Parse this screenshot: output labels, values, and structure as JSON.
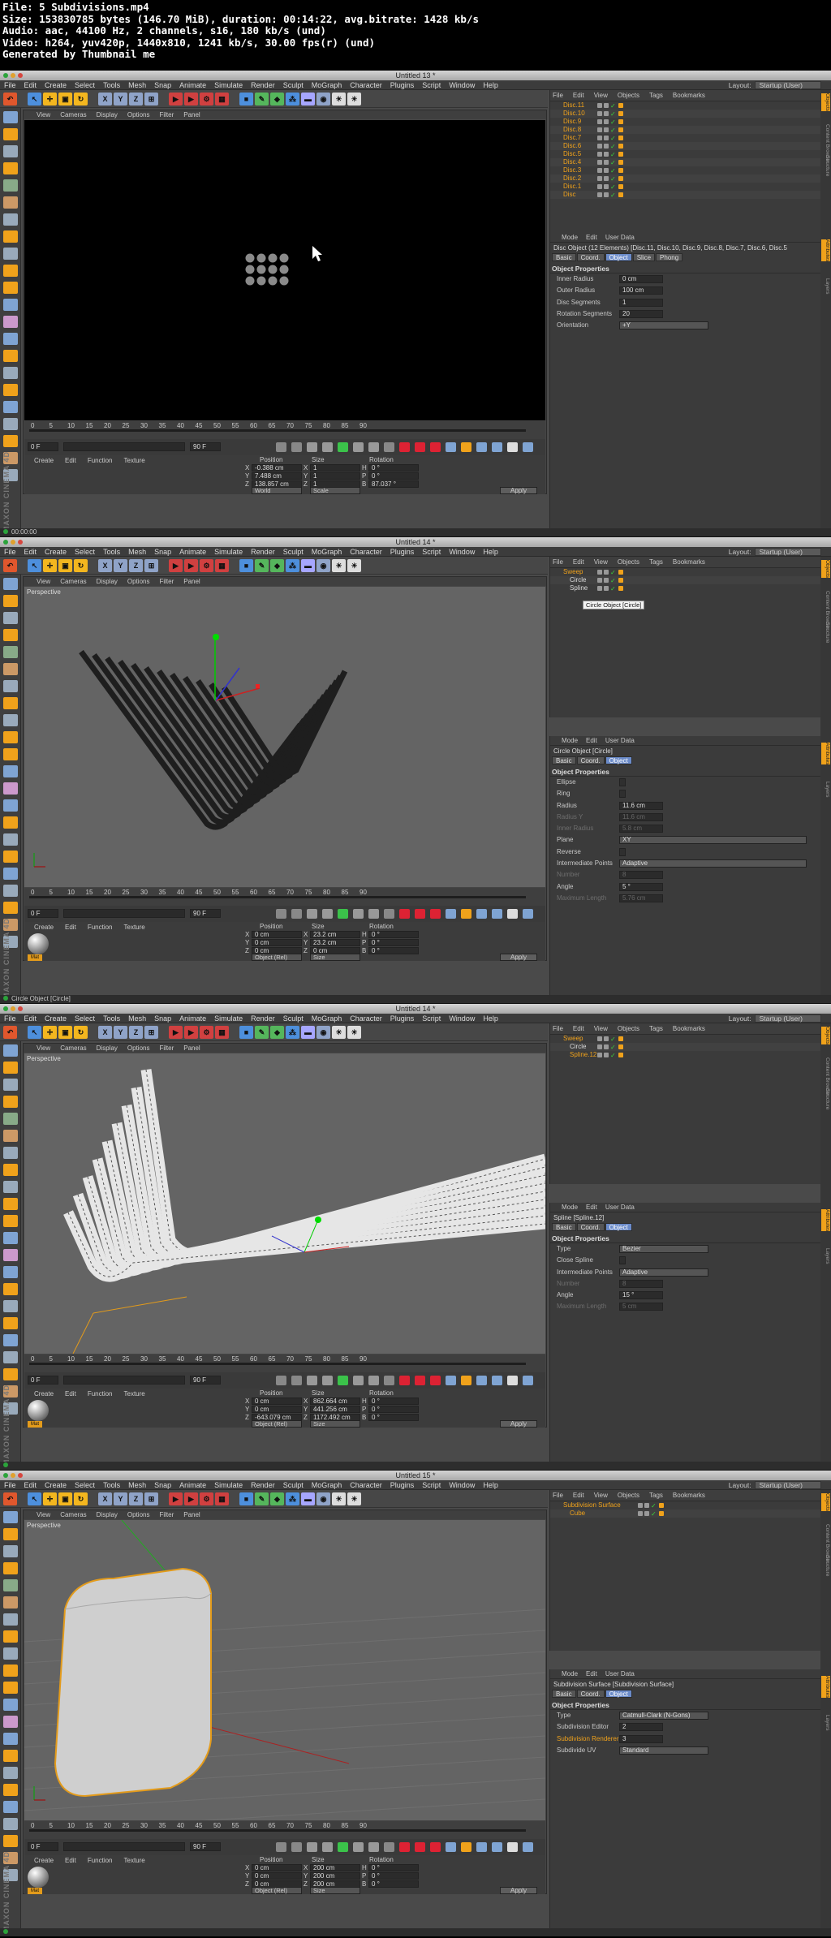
{
  "header": {
    "lines": [
      "File: 5 Subdivisions.mp4",
      "Size: 153830785 bytes (146.70 MiB), duration: 00:14:22, avg.bitrate: 1428 kb/s",
      "Audio: aac, 44100 Hz, 2 channels, s16, 180 kb/s (und)",
      "Video: h264, yuv420p, 1440x810, 1241 kb/s, 30.00 fps(r) (und)",
      "Generated by Thumbnail me"
    ]
  },
  "menu": [
    "File",
    "Edit",
    "Create",
    "Select",
    "Tools",
    "Mesh",
    "Snap",
    "Animate",
    "Simulate",
    "Render",
    "Sculpt",
    "MoGraph",
    "Character",
    "Plugins",
    "Script",
    "Window",
    "Help"
  ],
  "layout": {
    "label": "Layout:",
    "value": "Startup (User)"
  },
  "viewport_menu": [
    "View",
    "Cameras",
    "Display",
    "Options",
    "Filter",
    "Panel"
  ],
  "om_menu": [
    "File",
    "Edit",
    "View",
    "Objects",
    "Tags",
    "Bookmarks"
  ],
  "attr_menu": [
    "Mode",
    "Edit",
    "User Data"
  ],
  "material_menu": [
    "Create",
    "Edit",
    "Function",
    "Texture"
  ],
  "mat_label": "Mat",
  "ticks": [
    "0",
    "5",
    "10",
    "15",
    "20",
    "25",
    "30",
    "35",
    "40",
    "45",
    "50",
    "55",
    "60",
    "65",
    "70",
    "75",
    "80",
    "85",
    "90"
  ],
  "coord_heads": [
    "Position",
    "Size",
    "Rotation"
  ],
  "axes": [
    "X",
    "Y",
    "Z"
  ],
  "rot_axes": [
    "H",
    "P",
    "B"
  ],
  "apply": "Apply",
  "right_tabs": [
    "Attributes",
    "Layers"
  ],
  "right_tabs_top": [
    "Objects",
    "Content Browser",
    "Structure"
  ],
  "frames": [
    {
      "title": "Untitled 13 *",
      "viewport_label": "",
      "objects": [
        "Disc.11",
        "Disc.10",
        "Disc.9",
        "Disc.8",
        "Disc.7",
        "Disc.6",
        "Disc.5",
        "Disc.4",
        "Disc.3",
        "Disc.2",
        "Disc.1",
        "Disc"
      ],
      "attr_title": "Disc Object (12 Elements) [Disc.11, Disc.10, Disc.9, Disc.8, Disc.7, Disc.6, Disc.5",
      "tabs": [
        "Basic",
        "Coord.",
        "Object",
        "Slice",
        "Phong"
      ],
      "active_tab": "Object",
      "section": "Object Properties",
      "props": [
        {
          "label": "Inner Radius",
          "value": "0 cm",
          "kind": "num"
        },
        {
          "label": "Outer Radius",
          "value": "100 cm",
          "kind": "num"
        },
        {
          "label": "Disc Segments",
          "value": "1",
          "kind": "num"
        },
        {
          "label": "Rotation Segments",
          "value": "20",
          "kind": "num"
        },
        {
          "label": "Orientation",
          "value": "+Y",
          "kind": "drop"
        }
      ],
      "frame_start": "0 F",
      "frame_end": "90 F",
      "frame_cur": "0 F",
      "coords": {
        "pos": [
          "-0.388 cm",
          "7.488 cm",
          "138.857 cm"
        ],
        "size": [
          "1",
          "1",
          "1"
        ],
        "rot": [
          "0 °",
          "0 °",
          "87.037 °"
        ]
      },
      "drops": [
        "World",
        "Scale"
      ],
      "status": "00:00:00",
      "show_mat": false
    },
    {
      "title": "Untitled 14 *",
      "viewport_label": "Perspective",
      "objects": [
        "Sweep",
        "Circle",
        "Spline"
      ],
      "tooltip": "Circle Object [Circle]",
      "attr_title": "Circle Object [Circle]",
      "tabs": [
        "Basic",
        "Coord.",
        "Object"
      ],
      "active_tab": "Object",
      "section": "Object Properties",
      "props": [
        {
          "label": "Ellipse",
          "value": "",
          "kind": "box"
        },
        {
          "label": "Ring",
          "value": "",
          "kind": "box"
        },
        {
          "label": "Radius",
          "value": "11.6 cm",
          "kind": "num"
        },
        {
          "label": "Radius Y",
          "value": "11.6 cm",
          "kind": "dimnum"
        },
        {
          "label": "Inner Radius",
          "value": "5.8 cm",
          "kind": "dimnum"
        },
        {
          "label": "Plane",
          "value": "XY",
          "kind": "dropw"
        },
        {
          "label": "Reverse",
          "value": "",
          "kind": "box"
        },
        {
          "label": "Intermediate Points",
          "value": "Adaptive",
          "kind": "dropw"
        },
        {
          "label": "Number",
          "value": "8",
          "kind": "dimnum"
        },
        {
          "label": "Angle",
          "value": "5 °",
          "kind": "num"
        },
        {
          "label": "Maximum Length",
          "value": "5.76 cm",
          "kind": "dimnum"
        }
      ],
      "frame_start": "0 F",
      "frame_end": "90 F",
      "frame_cur": "0 F",
      "coords": {
        "pos": [
          "0 cm",
          "0 cm",
          "0 cm"
        ],
        "size": [
          "23.2 cm",
          "23.2 cm",
          "0 cm"
        ],
        "rot": [
          "0 °",
          "0 °",
          "0 °"
        ]
      },
      "drops": [
        "Object (Rel)",
        "Size"
      ],
      "status": "Circle Object [Circle]",
      "show_mat": true
    },
    {
      "title": "Untitled 14 *",
      "viewport_label": "Perspective",
      "objects": [
        "Sweep",
        "Circle",
        "Spline.12"
      ],
      "attr_title": "Spline [Spline.12]",
      "tabs": [
        "Basic",
        "Coord.",
        "Object"
      ],
      "active_tab": "Object",
      "section": "Object Properties",
      "props": [
        {
          "label": "Type",
          "value": "Bezier",
          "kind": "drop"
        },
        {
          "label": "Close Spline",
          "value": "",
          "kind": "box"
        },
        {
          "label": "Intermediate Points",
          "value": "Adaptive",
          "kind": "drop"
        },
        {
          "label": "Number",
          "value": "8",
          "kind": "dimnum"
        },
        {
          "label": "Angle",
          "value": "15 °",
          "kind": "num"
        },
        {
          "label": "Maximum Length",
          "value": "5 cm",
          "kind": "dimnum"
        }
      ],
      "frame_start": "0 F",
      "frame_end": "90 F",
      "frame_cur": "0 F",
      "coords": {
        "pos": [
          "0 cm",
          "0 cm",
          "-643.079 cm"
        ],
        "size": [
          "862.664 cm",
          "441.256 cm",
          "1172.492 cm"
        ],
        "rot": [
          "0 °",
          "0 °",
          "0 °"
        ]
      },
      "drops": [
        "Object (Rel)",
        "Size"
      ],
      "status": "",
      "show_mat": true
    },
    {
      "title": "Untitled 15 *",
      "viewport_label": "Perspective",
      "objects": [
        "Subdivision Surface",
        "Cube"
      ],
      "attr_title": "Subdivision Surface [Subdivision Surface]",
      "tabs": [
        "Basic",
        "Coord.",
        "Object"
      ],
      "active_tab": "Object",
      "section": "Object Properties",
      "props": [
        {
          "label": "Type",
          "value": "Catmull-Clark (N-Gons)",
          "kind": "drop"
        },
        {
          "label": "Subdivision Editor",
          "value": "2",
          "kind": "num"
        },
        {
          "label": "Subdivision Renderer",
          "value": "3",
          "kind": "numhl"
        },
        {
          "label": "Subdivide UV",
          "value": "Standard",
          "kind": "drop"
        }
      ],
      "frame_start": "0 F",
      "frame_end": "90 F",
      "frame_cur": "0 F",
      "coords": {
        "pos": [
          "0 cm",
          "0 cm",
          "0 cm"
        ],
        "size": [
          "200 cm",
          "200 cm",
          "200 cm"
        ],
        "rot": [
          "0 °",
          "0 °",
          "0 °"
        ]
      },
      "drops": [
        "Object (Rel)",
        "Size"
      ],
      "status": "",
      "show_mat": true
    }
  ]
}
